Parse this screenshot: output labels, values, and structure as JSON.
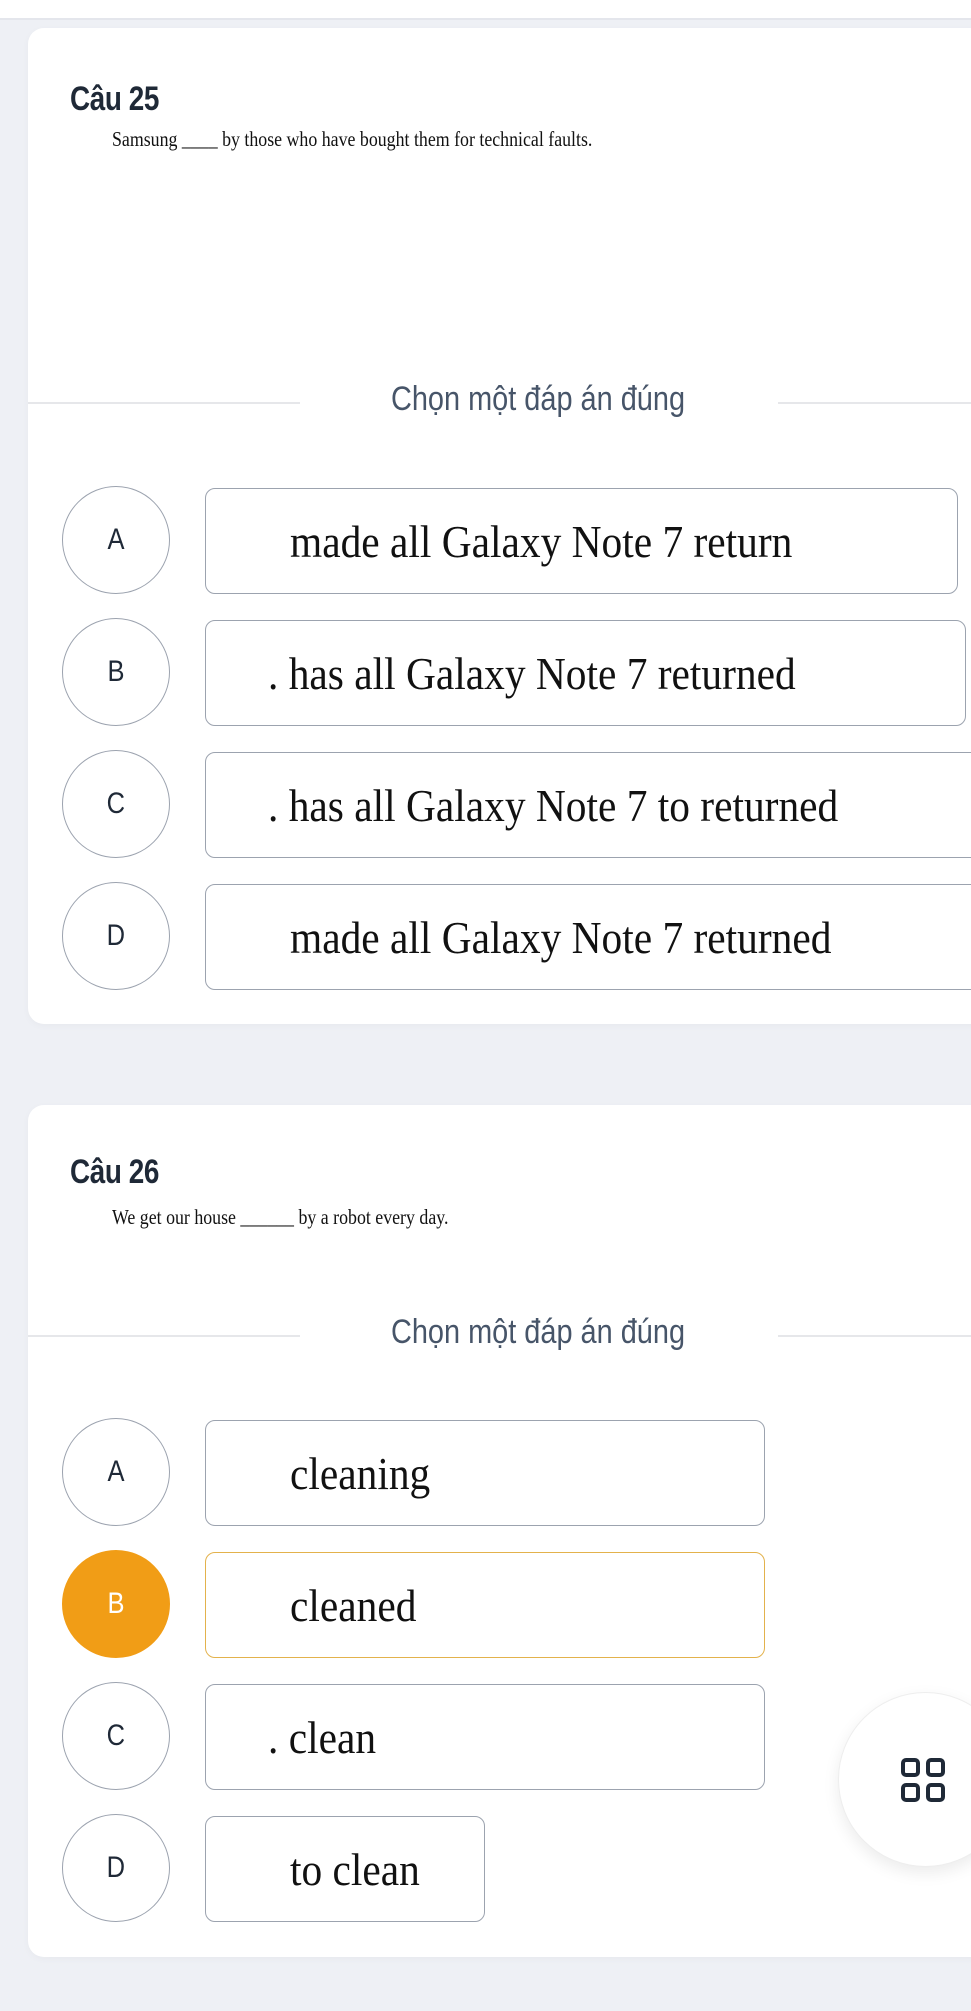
{
  "questions": [
    {
      "title": "Câu 25",
      "text": "Samsung ____ by those who have bought them for technical faults.",
      "prompt": "Chọn một đáp án đúng",
      "options": [
        {
          "letter": "A",
          "text": "made all Galaxy Note 7 return",
          "selected": false
        },
        {
          "letter": "B",
          "text": ". has all Galaxy Note 7 returned",
          "selected": false
        },
        {
          "letter": "C",
          "text": ". has all Galaxy Note 7 to returned",
          "selected": false
        },
        {
          "letter": "D",
          "text": "made all Galaxy Note 7 returned",
          "selected": false
        }
      ]
    },
    {
      "title": "Câu 26",
      "text": "We get our house ______ by a robot every day.",
      "prompt": "Chọn một đáp án đúng",
      "options": [
        {
          "letter": "A",
          "text": "cleaning",
          "selected": false
        },
        {
          "letter": "B",
          "text": "cleaned",
          "selected": true
        },
        {
          "letter": "C",
          "text": ". clean",
          "selected": false
        },
        {
          "letter": "D",
          "text": "to clean",
          "selected": false
        }
      ]
    }
  ],
  "fab": {
    "icon": "grid-icon"
  },
  "colors": {
    "selected": "#f19d16",
    "selected_border": "#e3b24c",
    "background": "#eef0f5"
  }
}
